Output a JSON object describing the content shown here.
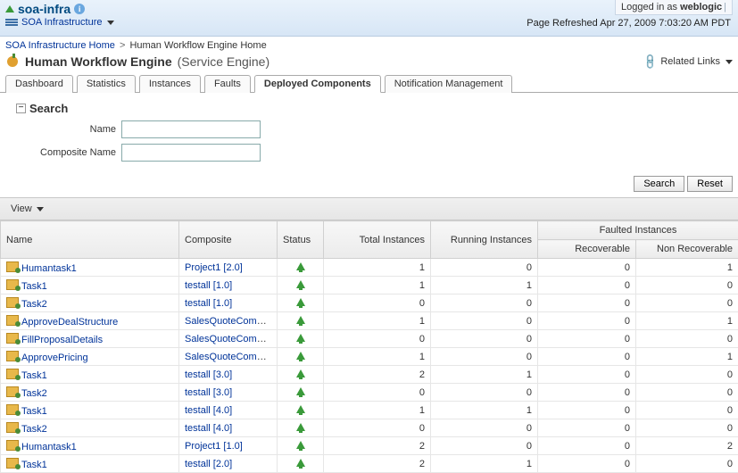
{
  "header": {
    "title": "soa-infra",
    "subtitle": "SOA Infrastructure",
    "login_prefix": "Logged in as ",
    "login_user": "weblogic",
    "refresh_label": "Page Refreshed ",
    "refresh_time": "Apr 27, 2009 7:03:20 AM PDT"
  },
  "breadcrumb": {
    "root": "SOA Infrastructure Home",
    "current": "Human Workflow Engine Home"
  },
  "page": {
    "title": "Human Workflow Engine",
    "engine_type": "(Service Engine)",
    "related_links": "Related Links"
  },
  "tabs": {
    "dashboard": "Dashboard",
    "statistics": "Statistics",
    "instances": "Instances",
    "faults": "Faults",
    "deployed": "Deployed Components",
    "notification": "Notification Management"
  },
  "search": {
    "title": "Search",
    "name_label": "Name",
    "composite_label": "Composite Name",
    "name_value": "",
    "composite_value": "",
    "search_btn": "Search",
    "reset_btn": "Reset"
  },
  "toolbar": {
    "view_label": "View"
  },
  "table": {
    "headers": {
      "name": "Name",
      "composite": "Composite",
      "status": "Status",
      "total": "Total Instances",
      "running": "Running Instances",
      "faulted_group": "Faulted Instances",
      "recoverable": "Recoverable",
      "non_recoverable": "Non Recoverable"
    },
    "rows": [
      {
        "name": "Humantask1",
        "composite": "Project1 [2.0]",
        "total": 1,
        "running": 0,
        "rec": 0,
        "nrec": 1
      },
      {
        "name": "Task1",
        "composite": "testall [1.0]",
        "total": 1,
        "running": 1,
        "rec": 0,
        "nrec": 0
      },
      {
        "name": "Task2",
        "composite": "testall [1.0]",
        "total": 0,
        "running": 0,
        "rec": 0,
        "nrec": 0
      },
      {
        "name": "ApproveDealStructure",
        "composite": "SalesQuoteComposit",
        "total": 1,
        "running": 0,
        "rec": 0,
        "nrec": 1
      },
      {
        "name": "FillProposalDetails",
        "composite": "SalesQuoteComposit",
        "total": 0,
        "running": 0,
        "rec": 0,
        "nrec": 0
      },
      {
        "name": "ApprovePricing",
        "composite": "SalesQuoteComposit",
        "total": 1,
        "running": 0,
        "rec": 0,
        "nrec": 1
      },
      {
        "name": "Task1",
        "composite": "testall [3.0]",
        "total": 2,
        "running": 1,
        "rec": 0,
        "nrec": 0
      },
      {
        "name": "Task2",
        "composite": "testall [3.0]",
        "total": 0,
        "running": 0,
        "rec": 0,
        "nrec": 0
      },
      {
        "name": "Task1",
        "composite": "testall [4.0]",
        "total": 1,
        "running": 1,
        "rec": 0,
        "nrec": 0
      },
      {
        "name": "Task2",
        "composite": "testall [4.0]",
        "total": 0,
        "running": 0,
        "rec": 0,
        "nrec": 0
      },
      {
        "name": "Humantask1",
        "composite": "Project1 [1.0]",
        "total": 2,
        "running": 0,
        "rec": 0,
        "nrec": 2
      },
      {
        "name": "Task1",
        "composite": "testall [2.0]",
        "total": 2,
        "running": 1,
        "rec": 0,
        "nrec": 0
      }
    ]
  }
}
